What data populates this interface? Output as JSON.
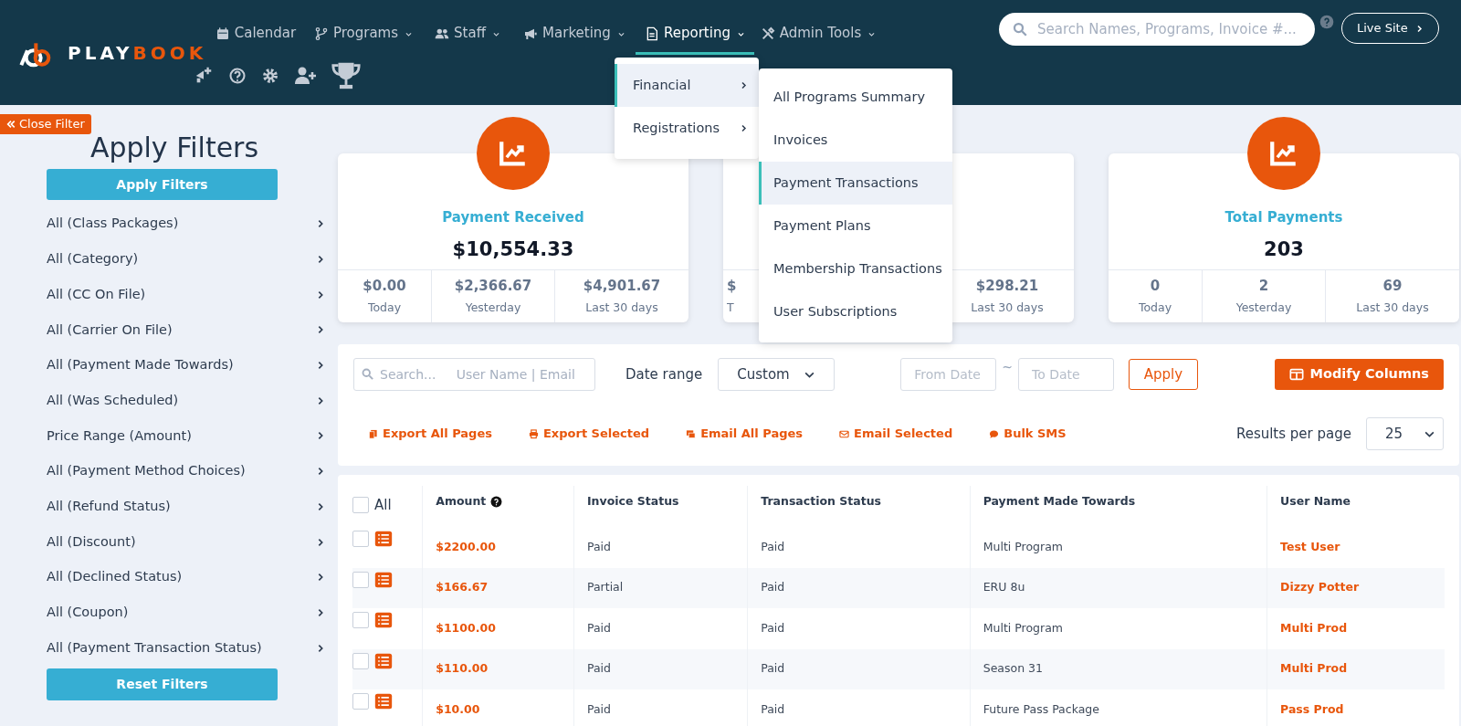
{
  "header": {
    "logo": {
      "part_1": "PLAY",
      "part_2": "BOOK"
    },
    "nav": [
      {
        "kind": "calendar",
        "label": "Calendar",
        "has_caret": false,
        "selected": false
      },
      {
        "kind": "programs",
        "label": "Programs",
        "has_caret": true,
        "selected": false
      },
      {
        "kind": "staff",
        "label": "Staff",
        "has_caret": true,
        "selected": false
      },
      {
        "kind": "marketing",
        "label": "Marketing",
        "has_caret": true,
        "selected": false
      },
      {
        "kind": "reporting",
        "label": "Reporting",
        "has_caret": true,
        "selected": true
      },
      {
        "kind": "admin",
        "label": "Admin Tools",
        "has_caret": true,
        "selected": false
      }
    ],
    "search": {
      "placeholder": "Search Names, Programs, Invoice #..."
    },
    "live_site": "Live Site"
  },
  "reporting_menu": {
    "items": [
      {
        "label": "Financial",
        "selected": true
      },
      {
        "label": "Registrations",
        "selected": false
      }
    ],
    "submenu": [
      {
        "label": "All Programs Summary",
        "selected": false
      },
      {
        "label": "Invoices",
        "selected": false
      },
      {
        "label": "Payment Transactions",
        "selected": true
      },
      {
        "label": "Payment Plans",
        "selected": false
      },
      {
        "label": "Membership Transactions",
        "selected": false
      },
      {
        "label": "User Subscriptions",
        "selected": false
      }
    ]
  },
  "sidebar": {
    "close_filter": "Close Filter",
    "title": "Apply Filters",
    "apply_button": "Apply Filters",
    "filters": [
      "All (Class Packages)",
      "All (Category)",
      "All (CC On File)",
      "All (Carrier On File)",
      "All (Payment Made Towards)",
      "All (Was Scheduled)",
      "Price Range (Amount)",
      "All (Payment Method Choices)",
      "All (Refund Status)",
      "All (Discount)",
      "All (Declined Status)",
      "All (Coupon)",
      "All (Payment Transaction Status)"
    ],
    "reset_button": "Reset Filters"
  },
  "cards": [
    {
      "title": "Payment Received",
      "value": "$10,554.33",
      "stats": [
        {
          "value": "$0.00",
          "label": "Today"
        },
        {
          "value": "$2,366.67",
          "label": "Yesterday"
        },
        {
          "value": "$4,901.67",
          "label": "Last 30 days"
        }
      ]
    },
    {
      "stats": [
        {
          "value": "$",
          "label": "T"
        },
        {
          "value": "$298.21",
          "label": "Last 30 days"
        }
      ]
    },
    {
      "title": "Total Payments",
      "value": "203",
      "stats": [
        {
          "value": "0",
          "label": "Today"
        },
        {
          "value": "2",
          "label": "Yesterday"
        },
        {
          "value": "69",
          "label": "Last 30 days"
        }
      ]
    }
  ],
  "toolbar": {
    "search_placeholder": "Search...     User Name | Email",
    "date_range_label": "Date range",
    "date_range": "Custom",
    "from_placeholder": "From Date",
    "separator": "~",
    "to_placeholder": "To Date",
    "apply": "Apply",
    "modify_columns": "Modify Columns",
    "actions": [
      {
        "kind": "export",
        "label": "Export All Pages"
      },
      {
        "kind": "print",
        "label": "Export Selected"
      },
      {
        "kind": "email_all",
        "label": "Email All Pages"
      },
      {
        "kind": "email",
        "label": "Email Selected"
      },
      {
        "kind": "sms",
        "label": "Bulk SMS"
      }
    ],
    "results_label": "Results per page",
    "results_value": "25"
  },
  "table": {
    "select_all": {
      "label": "All",
      "checked": false
    },
    "columns": [
      "Amount",
      "Invoice Status",
      "Transaction Status",
      "Payment Made Towards",
      "User Name"
    ],
    "rows": [
      {
        "checked": false,
        "cells": [
          "$2200.00",
          "Paid",
          "Paid",
          "Multi Program",
          "Test User"
        ]
      },
      {
        "checked": false,
        "cells": [
          "$166.67",
          "Partial",
          "Paid",
          "ERU 8u",
          "Dizzy Potter"
        ]
      },
      {
        "checked": false,
        "cells": [
          "$1100.00",
          "Paid",
          "Paid",
          "Multi Program",
          "Multi Prod"
        ]
      },
      {
        "checked": false,
        "cells": [
          "$110.00",
          "Paid",
          "Paid",
          "Season 31",
          "Multi Prod"
        ]
      },
      {
        "checked": false,
        "cells": [
          "$10.00",
          "Paid",
          "Paid",
          "Future Pass Package",
          "Pass Prod"
        ]
      }
    ]
  }
}
